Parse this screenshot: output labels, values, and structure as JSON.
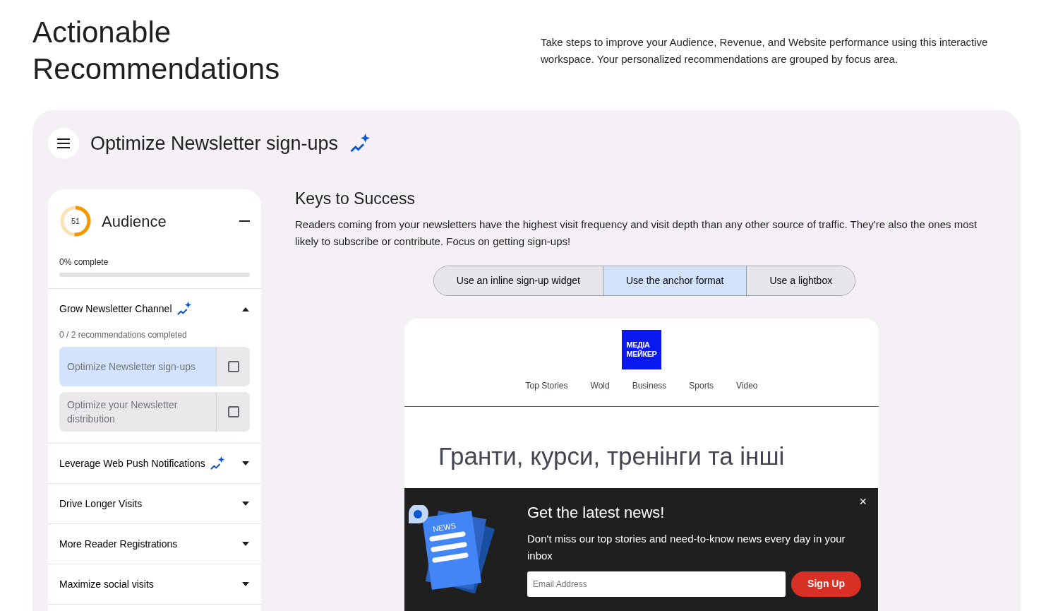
{
  "header": {
    "title": "Actionable Recommendations",
    "description": "Take steps to improve your Audience, Revenue, and Website performance using this interactive workspace. Your personalized recommendations are grouped by focus area."
  },
  "panel": {
    "title": "Optimize Newsletter sign-ups",
    "ai": true
  },
  "sidebar": {
    "score": {
      "text": "51",
      "level": 0.51
    },
    "title": "Audience",
    "expanded": true,
    "progress": {
      "label": "0% complete",
      "level": 0
    },
    "groups": [
      {
        "title": "Grow Newsletter Channel",
        "ai": true,
        "expanded": true,
        "count": "0 / 2 recommendations completed",
        "items": [
          {
            "label": "Optimize Newsletter sign-ups",
            "selected": true,
            "checked": false
          },
          {
            "label": "Optimize your Newsletter distribution",
            "selected": false,
            "checked": false
          }
        ]
      },
      {
        "title": "Leverage Web Push Notifications",
        "ai": true,
        "expanded": false
      },
      {
        "title": "Drive Longer Visits",
        "ai": false,
        "expanded": false
      },
      {
        "title": "More Reader Registrations",
        "ai": false,
        "expanded": false
      },
      {
        "title": "Maximize social visits",
        "ai": false,
        "expanded": false
      }
    ]
  },
  "content": {
    "heading": "Keys to Success",
    "text": "Readers coming from your newsletters have the highest visit frequency and visit depth than any other source of traffic. They're also the ones most likely to subscribe or contribute. Focus on getting sign-ups!",
    "options": [
      {
        "label": "Use an inline sign-up widget",
        "selected": false
      },
      {
        "label": "Use the anchor format",
        "selected": true
      },
      {
        "label": "Use a lightbox",
        "selected": false
      }
    ],
    "preview": {
      "logo": [
        "МЕДІА",
        "МЕЙКЕР"
      ],
      "nav": [
        "Top Stories",
        "Wold",
        "Business",
        "Sports",
        "Video"
      ],
      "headline": "Гранти, курси, тренінги та інші",
      "popup": {
        "illustration_label": "NEWS",
        "title": "Get the latest news!",
        "text": "Don't miss our top stories and need-to-know news every day in your inbox",
        "placeholder": "Email Address",
        "button": "Sign Up",
        "close": "×"
      }
    }
  }
}
